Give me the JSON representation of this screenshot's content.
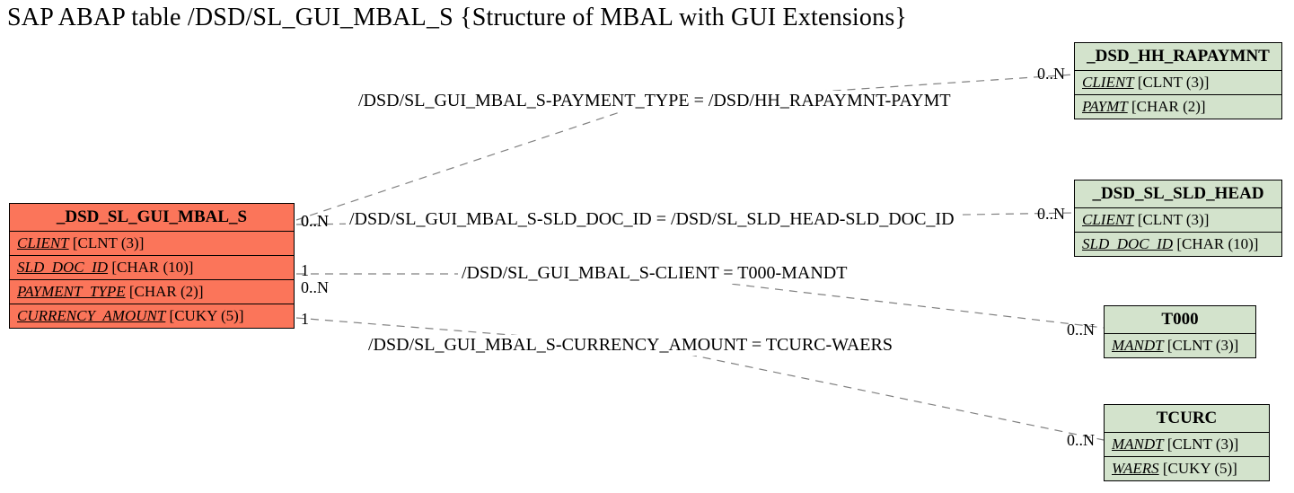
{
  "title": "SAP ABAP table /DSD/SL_GUI_MBAL_S {Structure of MBAL with GUI Extensions}",
  "main": {
    "name": "_DSD_SL_GUI_MBAL_S",
    "fields": {
      "f0": {
        "name": "CLIENT",
        "type": "[CLNT (3)]"
      },
      "f1": {
        "name": "SLD_DOC_ID",
        "type": "[CHAR (10)]"
      },
      "f2": {
        "name": "PAYMENT_TYPE",
        "type": "[CHAR (2)]"
      },
      "f3": {
        "name": "CURRENCY_AMOUNT",
        "type": "[CUKY (5)]"
      }
    }
  },
  "rels": {
    "r0": {
      "label": "/DSD/SL_GUI_MBAL_S-PAYMENT_TYPE = /DSD/HH_RAPAYMNT-PAYMT",
      "left_card": "0..N",
      "right_card": "0..N",
      "target": {
        "name": "_DSD_HH_RAPAYMNT",
        "fields": {
          "f0": {
            "name": "CLIENT",
            "type": "[CLNT (3)]"
          },
          "f1": {
            "name": "PAYMT",
            "type": "[CHAR (2)]"
          }
        }
      }
    },
    "r1": {
      "label": "/DSD/SL_GUI_MBAL_S-SLD_DOC_ID = /DSD/SL_SLD_HEAD-SLD_DOC_ID",
      "left_card": "0..N",
      "right_card": "0..N",
      "target": {
        "name": "_DSD_SL_SLD_HEAD",
        "fields": {
          "f0": {
            "name": "CLIENT",
            "type": "[CLNT (3)]"
          },
          "f1": {
            "name": "SLD_DOC_ID",
            "type": "[CHAR (10)]"
          }
        }
      }
    },
    "r2": {
      "label": "/DSD/SL_GUI_MBAL_S-CLIENT = T000-MANDT",
      "left_card": "1",
      "sub_card": "0..N",
      "right_card": "0..N",
      "target": {
        "name": "T000",
        "fields": {
          "f0": {
            "name": "MANDT",
            "type": "[CLNT (3)]"
          }
        }
      }
    },
    "r3": {
      "label": "/DSD/SL_GUI_MBAL_S-CURRENCY_AMOUNT = TCURC-WAERS",
      "left_card": "1",
      "right_card": "0..N",
      "target": {
        "name": "TCURC",
        "fields": {
          "f0": {
            "name": "MANDT",
            "type": "[CLNT (3)]"
          },
          "f1": {
            "name": "WAERS",
            "type": "[CUKY (5)]"
          }
        }
      }
    }
  },
  "colors": {
    "main_bg": "#fb755a",
    "rel_bg": "#d3e3cc"
  },
  "chart_data": {
    "type": "erd",
    "main_entity": "/DSD/SL_GUI_MBAL_S",
    "main_fields": [
      {
        "name": "CLIENT",
        "type": "CLNT(3)"
      },
      {
        "name": "SLD_DOC_ID",
        "type": "CHAR(10)"
      },
      {
        "name": "PAYMENT_TYPE",
        "type": "CHAR(2)"
      },
      {
        "name": "CURRENCY_AMOUNT",
        "type": "CUKY(5)"
      }
    ],
    "relations": [
      {
        "from_field": "PAYMENT_TYPE",
        "to_table": "/DSD/HH_RAPAYMNT",
        "to_field": "PAYMT",
        "left": "0..N",
        "right": "0..N",
        "target_fields": [
          {
            "name": "CLIENT",
            "type": "CLNT(3)"
          },
          {
            "name": "PAYMT",
            "type": "CHAR(2)"
          }
        ]
      },
      {
        "from_field": "SLD_DOC_ID",
        "to_table": "/DSD/SL_SLD_HEAD",
        "to_field": "SLD_DOC_ID",
        "left": "0..N",
        "right": "0..N",
        "target_fields": [
          {
            "name": "CLIENT",
            "type": "CLNT(3)"
          },
          {
            "name": "SLD_DOC_ID",
            "type": "CHAR(10)"
          }
        ]
      },
      {
        "from_field": "CLIENT",
        "to_table": "T000",
        "to_field": "MANDT",
        "left": "1",
        "right": "0..N",
        "sub": "0..N",
        "target_fields": [
          {
            "name": "MANDT",
            "type": "CLNT(3)"
          }
        ]
      },
      {
        "from_field": "CURRENCY_AMOUNT",
        "to_table": "TCURC",
        "to_field": "WAERS",
        "left": "1",
        "right": "0..N",
        "target_fields": [
          {
            "name": "MANDT",
            "type": "CLNT(3)"
          },
          {
            "name": "WAERS",
            "type": "CUKY(5)"
          }
        ]
      }
    ]
  }
}
